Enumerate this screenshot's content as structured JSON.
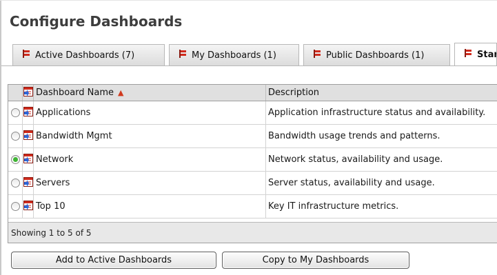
{
  "title": "Configure Dashboards",
  "tabs": [
    {
      "label": "Active Dashboards (7)",
      "icon": "dashboard-flag-icon"
    },
    {
      "label": "My Dashboards (1)",
      "icon": "dashboard-flag-icon"
    },
    {
      "label": "Public Dashboards (1)",
      "icon": "dashboard-flag-icon"
    },
    {
      "label": "Star",
      "icon": "dashboard-flag-icon"
    }
  ],
  "table": {
    "columns": {
      "name": "Dashboard Name",
      "description": "Description"
    },
    "sort": {
      "column": "Dashboard Name",
      "direction": "ascending",
      "icon": "sort-ascending-icon"
    },
    "rows": [
      {
        "name": "Applications",
        "description": "Application infrastructure status and availability.",
        "selected": false
      },
      {
        "name": "Bandwidth Mgmt",
        "description": "Bandwidth usage trends and patterns.",
        "selected": false
      },
      {
        "name": "Network",
        "description": "Network status, availability and usage.",
        "selected": true
      },
      {
        "name": "Servers",
        "description": "Server status, availability and usage.",
        "selected": false
      },
      {
        "name": "Top 10",
        "description": "Key IT infrastructure metrics.",
        "selected": false
      }
    ],
    "footer": "Showing 1 to 5 of 5"
  },
  "buttons": {
    "add": "Add to Active Dashboards",
    "copy": "Copy to My Dashboards"
  },
  "colors": {
    "selected_radio": "#3fb534",
    "flag_red": "#d02a1c",
    "dashboard_icon_blue": "#2a66d8"
  }
}
